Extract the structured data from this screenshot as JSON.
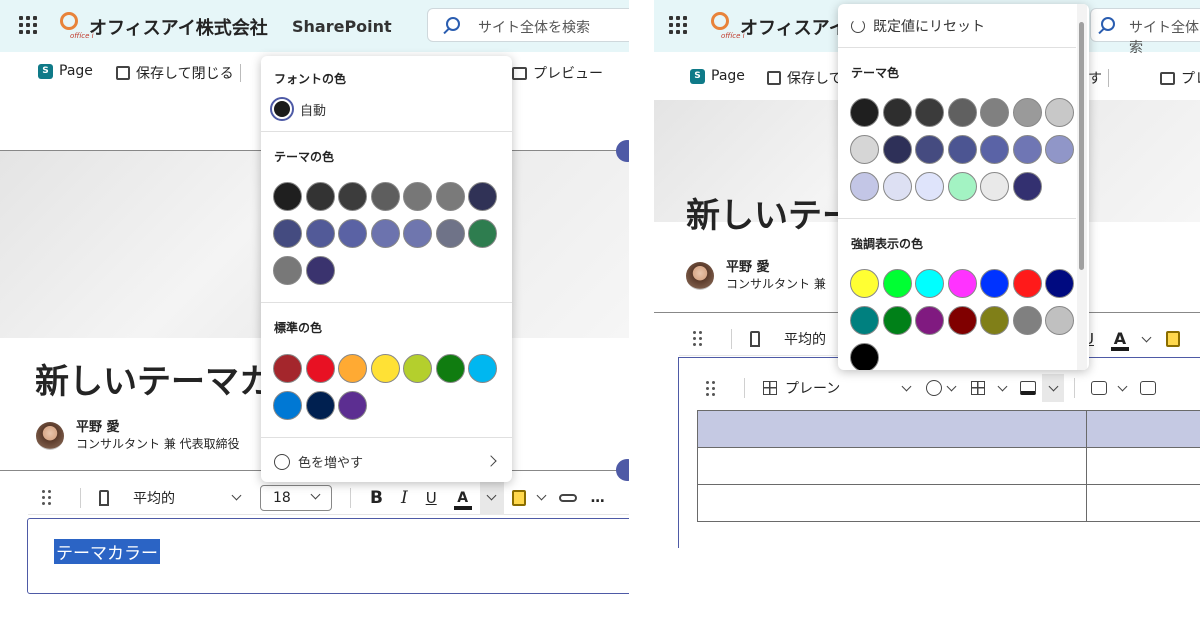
{
  "suite": {
    "company": "オフィスアイ株式会社",
    "product": "SharePoint",
    "search_placeholder": "サイト全体を検索",
    "logo_text": "offíce i"
  },
  "command_bar": {
    "page": "Page",
    "save_close": "保存して閉じる",
    "preview": "プレビュー",
    "undo": "戻す"
  },
  "page": {
    "title_left": "新しいテーマカ",
    "title_right": "新しいテー",
    "author_name": "平野 愛",
    "author_role_left": "コンサルタント 兼 代表取締役",
    "author_role_right": "コンサルタント 兼"
  },
  "format_toolbar": {
    "style": "平均的",
    "size": "18",
    "bold": "B",
    "italic": "I",
    "underline": "U",
    "font_color": "A",
    "more": "…"
  },
  "editor": {
    "selected_text": "テーマカラー"
  },
  "font_color_menu": {
    "header": "フォントの色",
    "auto_label": "自動",
    "theme_header": "テーマの色",
    "theme_colors": [
      "#1f1f1f",
      "#333333",
      "#3c3c3c",
      "#5e5e5e",
      "#777777",
      "#7a7a7a",
      "#303256",
      "#444b80",
      "#525a98",
      "#5a62a4",
      "#6c73ae",
      "#6f76ae",
      "#6f7388",
      "#2e7d4f",
      "#787878",
      "#3a336e"
    ],
    "standard_header": "標準の色",
    "standard_colors": [
      "#a4262c",
      "#e81123",
      "#ffaa33",
      "#ffe135",
      "#b4cf2d",
      "#107c10",
      "#00b7f0",
      "#0078d4",
      "#002050",
      "#5c2e91"
    ],
    "more_colors": "色を増やす"
  },
  "highlight_menu": {
    "reset": "既定値にリセット",
    "theme_header": "テーマ色",
    "theme_colors": [
      "#1f1f1f",
      "#2e2e2e",
      "#3b3b3b",
      "#606060",
      "#808080",
      "#9a9a9a",
      "#c8c8c8",
      "#d6d6d6",
      "#2e3058",
      "#454b80",
      "#4c5592",
      "#5a63a6",
      "#6f76b4",
      "#9096c8",
      "#c3c6e6",
      "#dde0f3",
      "#dfe4fb",
      "#a3f3c3",
      "#e9e9e9",
      "#333070"
    ],
    "emphasis_header": "強調表示の色",
    "emphasis_colors": [
      "#ffff33",
      "#00ff33",
      "#00ffff",
      "#ff33ff",
      "#0033ff",
      "#ff1a1a",
      "#000a80",
      "#00807f",
      "#008018",
      "#801a80",
      "#800000",
      "#807f18",
      "#808080",
      "#c0c0c0",
      "#000000"
    ]
  },
  "table_toolbar": {
    "style": "プレーン",
    "row_style": "平均的"
  }
}
